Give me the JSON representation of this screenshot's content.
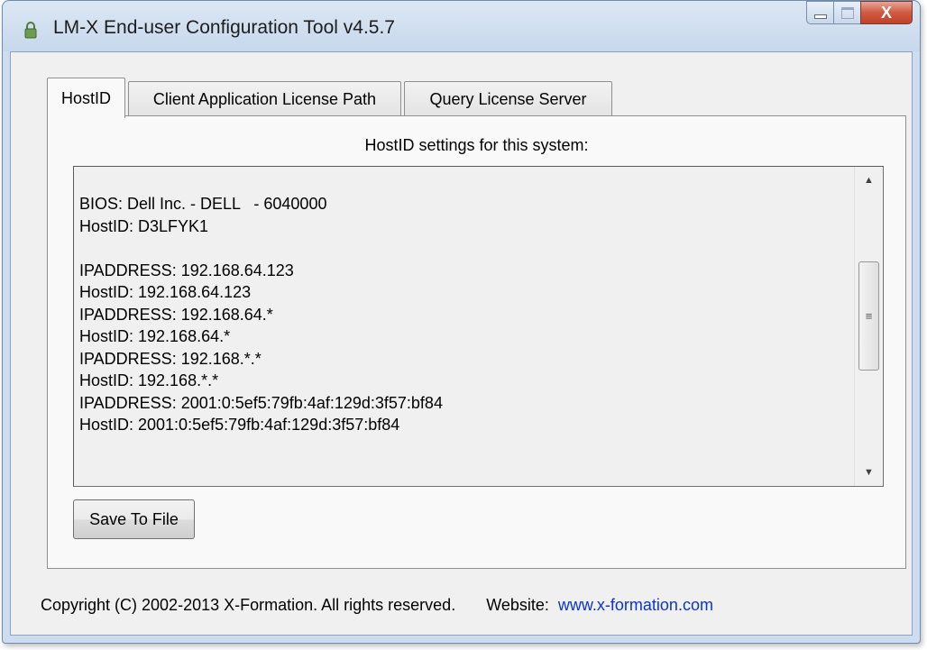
{
  "window": {
    "title": "LM-X End-user Configuration Tool v4.5.7",
    "close_symbol": "X"
  },
  "tabs": [
    {
      "label": "HostID",
      "active": true
    },
    {
      "label": "Client Application License Path",
      "active": false
    },
    {
      "label": "Query License Server",
      "active": false
    }
  ],
  "hostid_panel": {
    "heading": "HostID settings for this system:",
    "lines": [
      "BIOS: Dell Inc. - DELL   - 6040000",
      "HostID: D3LFYK1",
      "",
      "IPADDRESS: 192.168.64.123",
      "HostID: 192.168.64.123",
      "IPADDRESS: 192.168.64.*",
      "HostID: 192.168.64.*",
      "IPADDRESS: 192.168.*.*",
      "HostID: 192.168.*.*",
      "IPADDRESS: 2001:0:5ef5:79fb:4af:129d:3f57:bf84",
      "HostID: 2001:0:5ef5:79fb:4af:129d:3f57:bf84"
    ],
    "scroll_up_icon": "triangle-up",
    "scroll_down_icon": "triangle-down",
    "scroll_grip_icon": "grip-lines",
    "save_button_label": "Save To File"
  },
  "footer": {
    "copyright": "Copyright (C) 2002-2013 X-Formation. All rights reserved.",
    "website_label": "Website:",
    "website_link": "www.x-formation.com"
  },
  "colors": {
    "link": "#0a33d6",
    "close_button": "#c04228"
  }
}
